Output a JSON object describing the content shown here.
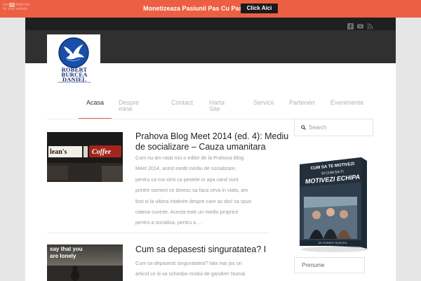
{
  "hellobar": {
    "credit_line1": "Get",
    "credit_badge": "HB",
    "credit_line1_tail": "Hello Bar",
    "credit_line2": "for your website",
    "message": "Monetizeaza Pasiunil Pas Cu Pas",
    "button_label": "Click Aici",
    "background_color": "#ec5f43"
  },
  "social": {
    "icons": [
      "facebook-icon",
      "youtube-icon",
      "rss-icon"
    ]
  },
  "logo": {
    "name_line1": "ROBERT",
    "name_line2": "BURCEA",
    "name_line3": "DANIEL",
    "tagline": "online money network entrepreneur"
  },
  "nav": {
    "items": [
      {
        "label": "Acasa"
      },
      {
        "label_line1": "Despre",
        "label_line2": "mine"
      },
      {
        "label": "Contact"
      },
      {
        "label_line1": "Harta",
        "label_line2": "Site"
      },
      {
        "label": "Servicii"
      },
      {
        "label": "Parteneri"
      },
      {
        "label": "Evenimente"
      }
    ],
    "active_index": 0,
    "accent_color": "#ec5f43"
  },
  "posts": [
    {
      "title_line1": "Prahova Blog Meet 2014 (ed. 4): Mediu",
      "title_line2": "de socializare – Cauza umanitara",
      "thumb_text_1": "lean's",
      "thumb_text_2": "Coffee",
      "excerpt_lines": [
        "Cum nu am ratat nici o editie de la Prahova Blog",
        "Meet 2014, acest inedit mediu de socializare,",
        "pentru ca ma simt ca pestele in apa cand sunt",
        "printre oameni ce doresc sa faca ceva in viata, am",
        "fost si la ultima intalnire despre care as dori sa spun",
        "cateva cuvinte. Acesta este un mediu proprice",
        "pentru a socializa, pentru a ..."
      ]
    },
    {
      "title_line1": "Cum sa depasesti singuratatea? I",
      "thumb_text_1": "say that you",
      "thumb_text_2": "are lonely",
      "excerpt_lines": [
        "Cum sa depasesti singuratatea? Iata mai jos un",
        "articol ce iti va schimba modul de gandire! Numai"
      ]
    }
  ],
  "sidebar": {
    "search_placeholder": "Search",
    "book": {
      "line1": "CUM SA TE MOTIVEZI",
      "line2": "SI CUM SA-TI",
      "line3": "MOTIVEZI ECHIPA",
      "author": "DE ROBERT BURCEA"
    },
    "name_placeholder": "Prenume"
  }
}
